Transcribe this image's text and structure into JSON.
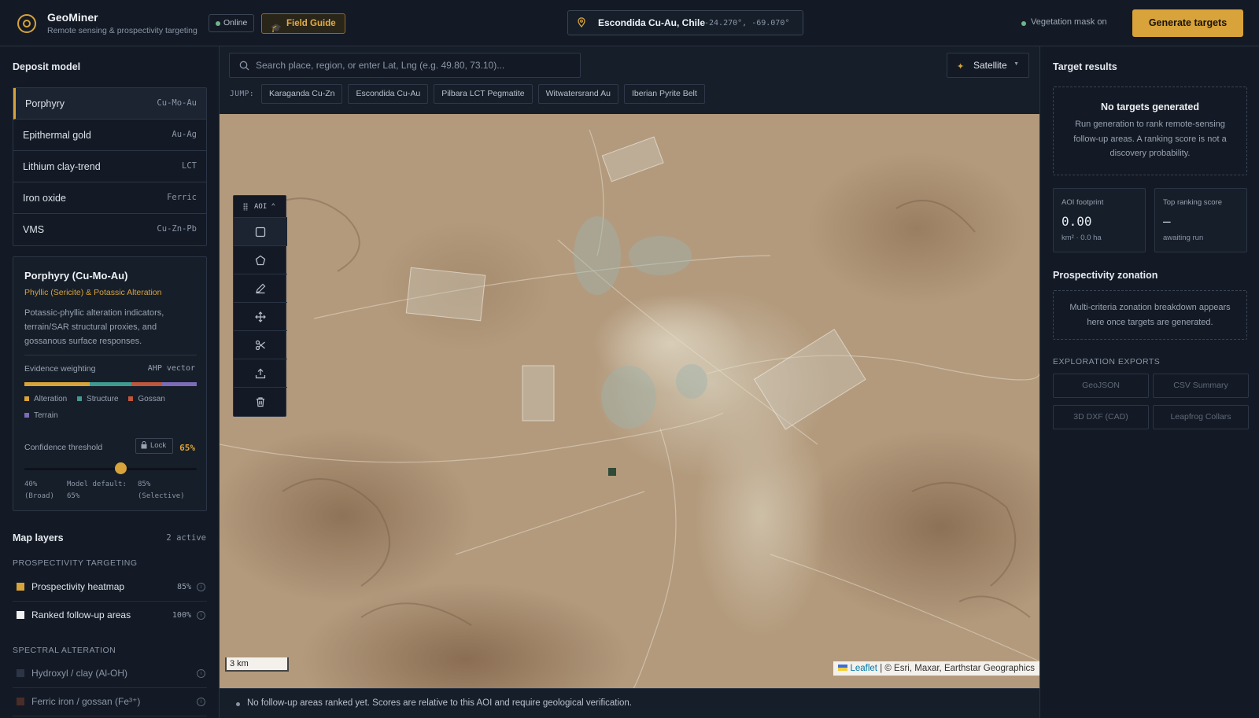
{
  "header": {
    "app_title": "GeoMiner",
    "app_subtitle": "Remote sensing & prospectivity targeting",
    "status_badge": "Online",
    "field_guide_label": "Field Guide",
    "location_name": "Escondida Cu-Au, Chile",
    "location_coords": "-24.270°, -69.070°",
    "vegetation_mask": "Vegetation mask on",
    "generate_label": "Generate targets"
  },
  "deposit_model": {
    "title": "Deposit model",
    "models": [
      {
        "label": "Porphyry",
        "code": "Cu-Mo-Au",
        "active": true
      },
      {
        "label": "Epithermal gold",
        "code": "Au-Ag"
      },
      {
        "label": "Lithium clay-trend",
        "code": "LCT"
      },
      {
        "label": "Iron oxide",
        "code": "Ferric"
      },
      {
        "label": "VMS",
        "code": "Cu-Zn-Pb"
      }
    ],
    "card": {
      "title": "Porphyry (Cu-Mo-Au)",
      "subtitle": "Phyllic (Sericite) & Potassic Alteration",
      "description": "Potassic-phyllic alteration indicators, terrain/SAR structural proxies, and gossanous surface responses.",
      "evidence_label": "Evidence weighting",
      "evidence_method": "AHP vector",
      "weights": [
        {
          "name": "Alteration",
          "color": "#d8a33a",
          "share": 0.38
        },
        {
          "name": "Structure",
          "color": "#3f9a8f",
          "share": 0.24
        },
        {
          "name": "Gossan",
          "color": "#c0563b",
          "share": 0.18
        },
        {
          "name": "Terrain",
          "color": "#7d6bb5",
          "share": 0.2
        }
      ],
      "confidence_label": "Confidence threshold",
      "lock_label": "Lock",
      "confidence_value": "65%",
      "confidence_fraction": 0.555,
      "slider_min": "40%",
      "slider_min_note": "(Broad)",
      "slider_default": "Model default:",
      "slider_default_val": "65%",
      "slider_max": "85%",
      "slider_max_note": "(Selective)"
    }
  },
  "layers": {
    "title": "Map layers",
    "count": "2 active",
    "group1": "PROSPECTIVITY TARGETING",
    "group2": "SPECTRAL ALTERATION",
    "items": [
      {
        "name": "Prospectivity heatmap",
        "pct": "85%",
        "color": "#d8a33a"
      },
      {
        "name": "Ranked follow-up areas",
        "pct": "100%",
        "color": "#f0f0f0"
      },
      {
        "name": "Hydroxyl / clay (Al-OH)",
        "pct": "",
        "color": "#2c3545"
      },
      {
        "name": "Ferric iron / gossan (Fe³⁺)",
        "pct": "",
        "color": "#4a2c28"
      }
    ]
  },
  "map": {
    "search_placeholder": "Search place, region, or enter Lat, Lng (e.g. 49.80, 73.10)...",
    "basemap": "Satellite",
    "jump_label": "JUMP:",
    "jumps": [
      "Karaganda Cu-Zn",
      "Escondida Cu-Au",
      "Pilbara LCT Pegmatite",
      "Witwatersrand Au",
      "Iberian Pyrite Belt"
    ],
    "aoi_label": "AOI",
    "scale": "3 km",
    "attribution_leaflet": "Leaflet",
    "attribution_rest": "| © Esri, Maxar, Earthstar Geographics",
    "status": "No follow-up areas ranked yet. Scores are relative to this AOI and require geological verification."
  },
  "results": {
    "title": "Target results",
    "empty_title": "No targets generated",
    "empty_desc": "Run generation to rank remote-sensing follow-up areas. A ranking score is not a discovery probability.",
    "aoi_label": "AOI footprint",
    "aoi_value": "0.00",
    "aoi_sub": "km² · 0.0 ha",
    "top_label": "Top ranking score",
    "top_value": "—",
    "top_sub": "awaiting run",
    "zonation_title": "Prospectivity zonation",
    "zonation_desc": "Multi-criteria zonation breakdown appears here once targets are generated.",
    "exports_title": "EXPLORATION EXPORTS",
    "exports": [
      "GeoJSON",
      "CSV Summary",
      "3D DXF (CAD)",
      "Leapfrog Collars"
    ]
  }
}
